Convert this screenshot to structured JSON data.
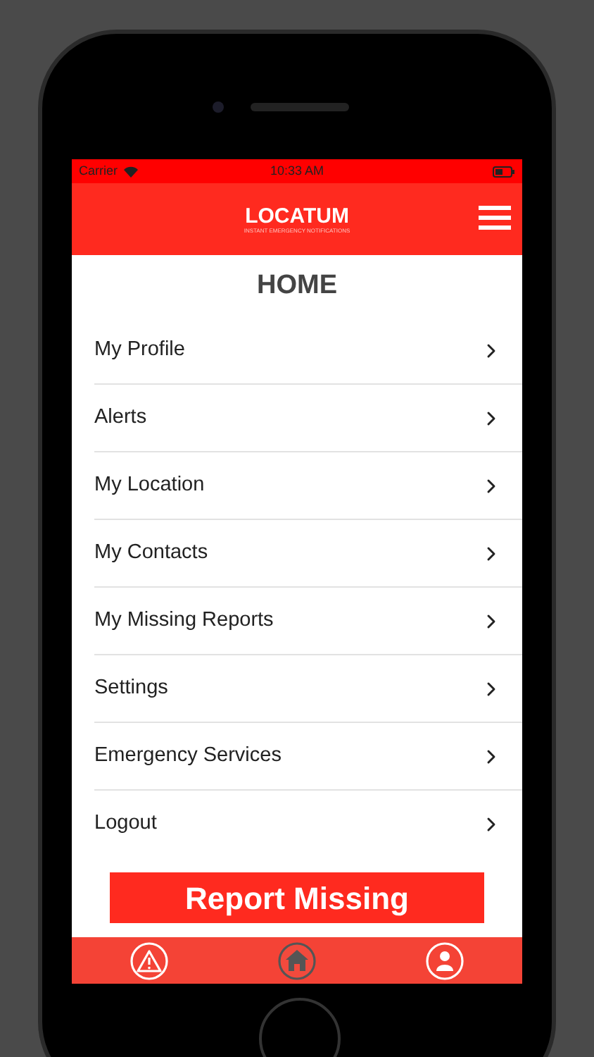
{
  "status_bar": {
    "carrier": "Carrier",
    "time": "10:33 AM"
  },
  "header": {
    "logo": "LOCATUM",
    "tagline": "INSTANT EMERGENCY NOTIFICATIONS"
  },
  "title": "HOME",
  "menu": [
    {
      "label": "My Profile"
    },
    {
      "label": "Alerts"
    },
    {
      "label": "My Location"
    },
    {
      "label": "My Contacts"
    },
    {
      "label": "My Missing Reports"
    },
    {
      "label": "Settings"
    },
    {
      "label": "Emergency Services"
    },
    {
      "label": "Logout"
    }
  ],
  "report_button": "Report Missing",
  "tab_bar": [
    {
      "kind": "alert",
      "selected": false
    },
    {
      "kind": "home",
      "selected": true
    },
    {
      "kind": "profile",
      "selected": false
    }
  ]
}
